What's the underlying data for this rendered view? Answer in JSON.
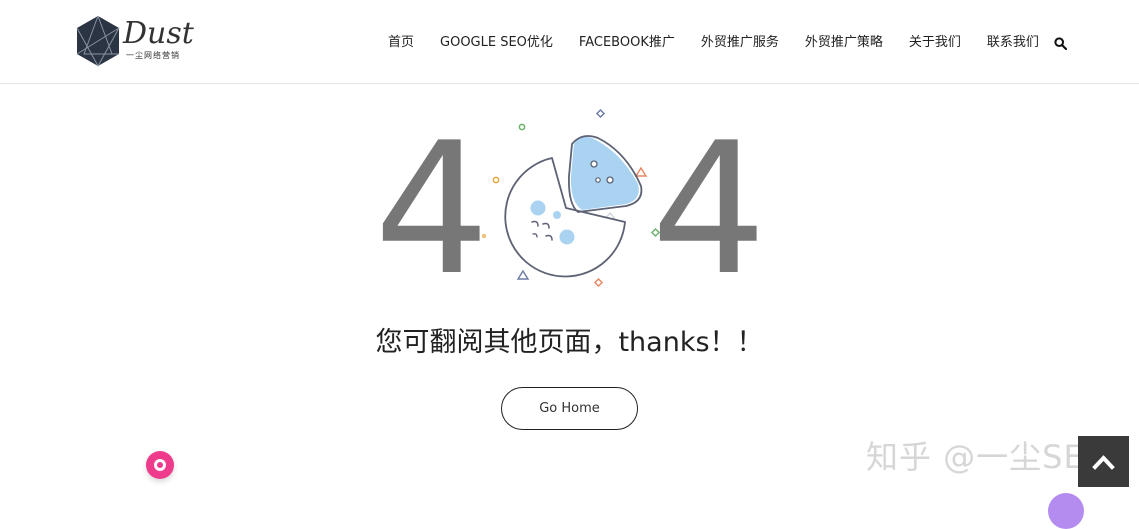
{
  "header": {
    "logo": {
      "word": "Dust",
      "tagline": "一尘网络营销"
    },
    "nav": [
      {
        "label": "首页"
      },
      {
        "label": "GOOGLE SEO优化"
      },
      {
        "label": "FACEBOOK推广"
      },
      {
        "label": "外贸推广服务"
      },
      {
        "label": "外贸推广策略"
      },
      {
        "label": "关于我们"
      },
      {
        "label": "联系我们"
      }
    ],
    "search_icon": "search-icon"
  },
  "error": {
    "digit_left": "4",
    "digit_right": "4",
    "illustration": "pie-chart-zero-icon",
    "message": "您可翻阅其他页面，thanks！！",
    "button_label": "Go Home"
  },
  "overlays": {
    "watermark": "知乎 @一尘SEO",
    "chat_icon": "chat-bubble-icon",
    "back_to_top_icon": "chevron-up-icon"
  },
  "colors": {
    "digit": "#777777",
    "pie_fill": "#a9d3f1",
    "chat": "#ee3b8b",
    "back_to_top": "#3a3a3a"
  }
}
